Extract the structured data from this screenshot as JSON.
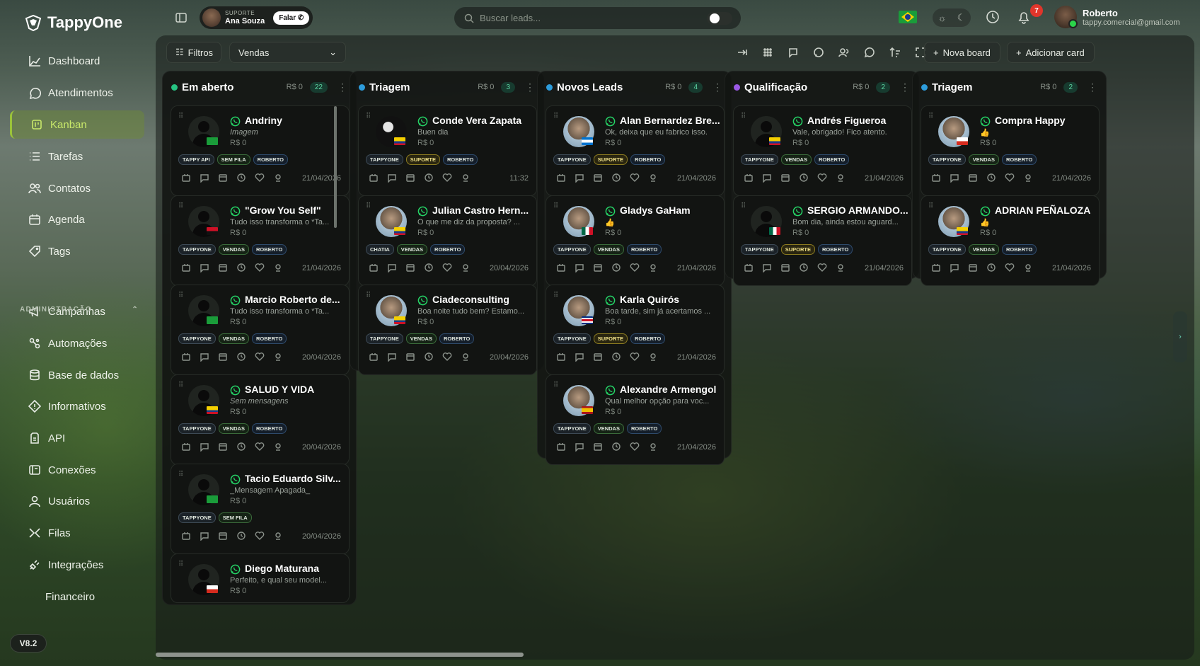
{
  "brand": {
    "name": "TappyOne",
    "version": "V8.2"
  },
  "nav": {
    "items": [
      {
        "label": "Dashboard",
        "icon": "chart-line-icon"
      },
      {
        "label": "Atendimentos",
        "icon": "chat-bubble-icon"
      },
      {
        "label": "Kanban",
        "icon": "kanban-icon",
        "active": true
      },
      {
        "label": "Tarefas",
        "icon": "list-icon"
      },
      {
        "label": "Contatos",
        "icon": "users-icon"
      },
      {
        "label": "Agenda",
        "icon": "calendar-icon"
      },
      {
        "label": "Tags",
        "icon": "tag-icon"
      }
    ],
    "admin_header": "ADMINISTRAÇÃO",
    "admin_items": [
      {
        "label": "Campanhas",
        "icon": "megaphone-icon"
      },
      {
        "label": "Automações",
        "icon": "automation-icon"
      },
      {
        "label": "Base de dados",
        "icon": "database-icon"
      },
      {
        "label": "Informativos",
        "icon": "info-icon"
      },
      {
        "label": "API",
        "icon": "api-icon"
      },
      {
        "label": "Conexões",
        "icon": "connection-icon"
      },
      {
        "label": "Usuários",
        "icon": "user-icon"
      },
      {
        "label": "Filas",
        "icon": "queue-icon"
      },
      {
        "label": "Integrações",
        "icon": "plug-icon"
      },
      {
        "label": "Financeiro",
        "icon": "money-icon"
      }
    ]
  },
  "topbar": {
    "agent_role": "SUPORTE",
    "agent_name": "Ana Souza",
    "talk_label": "Falar",
    "search_placeholder": "Buscar leads...",
    "notifications": "7",
    "user_name": "Roberto",
    "user_email": "tappy.comercial@gmail.com"
  },
  "toolbar": {
    "filters_label": "Filtros",
    "board_select": "Vendas",
    "new_board_label": "Nova board",
    "add_card_label": "Adicionar card"
  },
  "columns": [
    {
      "title": "Em aberto",
      "amount": "R$ 0",
      "count": "22",
      "color": "#26c281",
      "cards": [
        {
          "name": "Andriny",
          "msg": "Imagem",
          "msg_italic": true,
          "value": "R$ 0",
          "tags": [
            "TAPPY API",
            "SEM FILA",
            "ROBERTO"
          ],
          "date": "21/04/2026",
          "flag": "br",
          "avatar": "ph"
        },
        {
          "name": "\"Grow You Self\"",
          "msg": "Tudo isso transforma o *Ta...",
          "value": "R$ 0",
          "tags": [
            "TAPPYONE",
            "VENDAS",
            "ROBERTO"
          ],
          "date": "21/04/2026",
          "flag": "ao",
          "avatar": "ph"
        },
        {
          "name": "Marcio Roberto de...",
          "msg": "Tudo isso transforma o *Ta...",
          "value": "R$ 0",
          "tags": [
            "TAPPYONE",
            "VENDAS",
            "ROBERTO"
          ],
          "date": "20/04/2026",
          "flag": "br",
          "avatar": "ph"
        },
        {
          "name": "SALUD Y VIDA",
          "msg": "Sem mensagens",
          "msg_italic": true,
          "value": "R$ 0",
          "tags": [
            "TAPPYONE",
            "VENDAS",
            "ROBERTO"
          ],
          "date": "20/04/2026",
          "flag": "ec",
          "avatar": "ph"
        },
        {
          "name": "Tacio Eduardo Silv...",
          "msg": "_Mensagem Apagada_",
          "value": "R$ 0",
          "tags": [
            "TAPPYONE",
            "SEM FILA"
          ],
          "date": "20/04/2026",
          "flag": "br",
          "avatar": "ph"
        },
        {
          "name": "Diego Maturana",
          "msg": "Perfeito, e qual seu model...",
          "value": "R$ 0",
          "tags": [],
          "date": "",
          "flag": "cl",
          "avatar": "ph"
        }
      ]
    },
    {
      "title": "Triagem",
      "amount": "R$ 0",
      "count": "3",
      "color": "#2d9cdb",
      "cards": [
        {
          "name": "Conde Vera Zapata",
          "msg": "Buen dia",
          "value": "R$ 0",
          "tags": [
            "TAPPYONE",
            "SUPORTE",
            "ROBERTO"
          ],
          "date": "11:32",
          "flag": "co",
          "avatar": "dark"
        },
        {
          "name": "Julian Castro Hern...",
          "msg": "O que me diz da proposta? ...",
          "value": "R$ 0",
          "tags": [
            "CHATIA",
            "VENDAS",
            "ROBERTO"
          ],
          "date": "20/04/2026",
          "flag": "co",
          "avatar": "photo"
        },
        {
          "name": "Ciadeconsulting",
          "msg": "Boa noite tudo bem? Estamo...",
          "value": "R$ 0",
          "tags": [
            "TAPPYONE",
            "VENDAS",
            "ROBERTO"
          ],
          "date": "20/04/2026",
          "flag": "ec",
          "avatar": "photo"
        }
      ]
    },
    {
      "title": "Novos Leads",
      "amount": "R$ 0",
      "count": "4",
      "color": "#2d9cdb",
      "cards": [
        {
          "name": "Alan Bernardez Bre...",
          "msg": "Ok, deixa que eu fabrico isso.",
          "value": "R$ 0",
          "tags": [
            "TAPPYONE",
            "SUPORTE",
            "ROBERTO"
          ],
          "date": "21/04/2026",
          "flag": "hn",
          "avatar": "photo"
        },
        {
          "name": "Gladys GaHam",
          "msg": "👍",
          "value": "R$ 0",
          "tags": [
            "TAPPYONE",
            "VENDAS",
            "ROBERTO"
          ],
          "date": "21/04/2026",
          "flag": "mx",
          "avatar": "photo"
        },
        {
          "name": "Karla Quirós",
          "msg": "Boa tarde, sim já acertamos ...",
          "value": "R$ 0",
          "tags": [
            "TAPPYONE",
            "SUPORTE",
            "ROBERTO"
          ],
          "date": "21/04/2026",
          "flag": "cr",
          "avatar": "photo"
        },
        {
          "name": "Alexandre Armengol",
          "msg": "Qual melhor opção para voc...",
          "value": "R$ 0",
          "tags": [
            "TAPPYONE",
            "VENDAS",
            "ROBERTO"
          ],
          "date": "21/04/2026",
          "flag": "es",
          "avatar": "photo"
        }
      ]
    },
    {
      "title": "Qualificação",
      "amount": "R$ 0",
      "count": "2",
      "color": "#9b59e6",
      "cards": [
        {
          "name": "Andrés Figueroa",
          "msg": "Vale, obrigado! Fico atento.",
          "value": "R$ 0",
          "tags": [
            "TAPPYONE",
            "VENDAS",
            "ROBERTO"
          ],
          "date": "21/04/2026",
          "flag": "co",
          "avatar": "ph"
        },
        {
          "name": "SERGIO ARMANDO...",
          "msg": "Bom dia, ainda estou aguard...",
          "value": "R$ 0",
          "tags": [
            "TAPPYONE",
            "SUPORTE",
            "ROBERTO"
          ],
          "date": "21/04/2026",
          "flag": "mx",
          "avatar": "ph"
        }
      ]
    },
    {
      "title": "Triagem",
      "amount": "R$ 0",
      "count": "2",
      "color": "#2d9cdb",
      "cards": [
        {
          "name": "Compra Happy",
          "msg": "👍",
          "value": "R$ 0",
          "tags": [
            "TAPPYONE",
            "VENDAS",
            "ROBERTO"
          ],
          "date": "21/04/2026",
          "flag": "cl",
          "avatar": "photo"
        },
        {
          "name": "ADRIAN PEÑALOZA",
          "msg": "👍",
          "value": "R$ 0",
          "tags": [
            "TAPPYONE",
            "VENDAS",
            "ROBERTO"
          ],
          "date": "21/04/2026",
          "flag": "co",
          "avatar": "photo"
        }
      ]
    }
  ]
}
